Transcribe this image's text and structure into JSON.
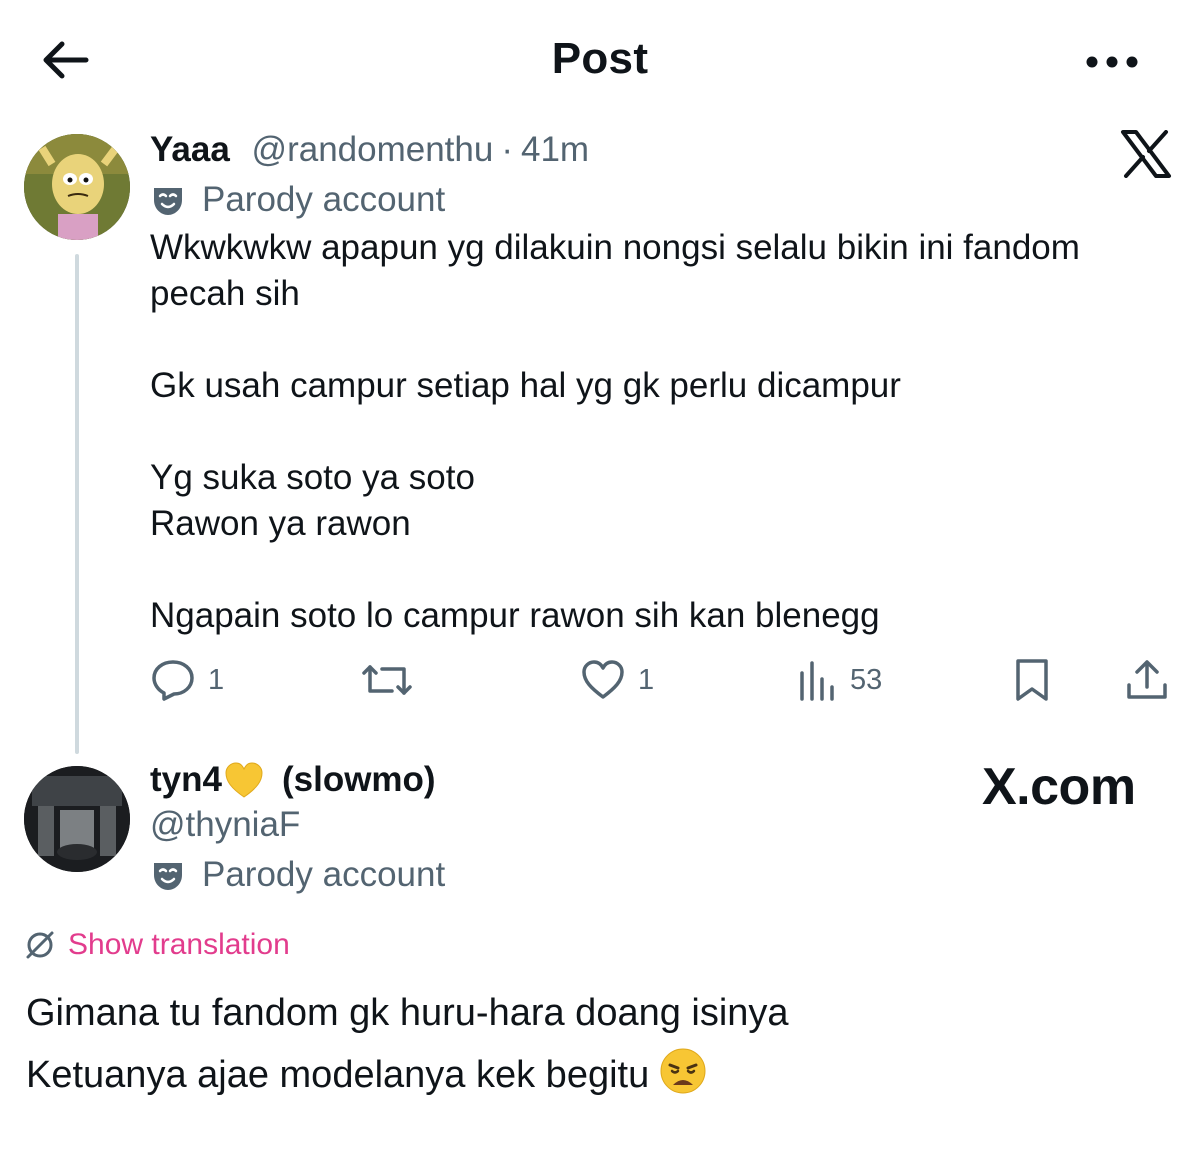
{
  "header": {
    "title": "Post",
    "back_icon": "arrow-left-icon",
    "more_icon": "more-horizontal-icon"
  },
  "parent_post": {
    "display_name": "Yaaa",
    "handle": "@randomenthu",
    "separator": "·",
    "time": "41m",
    "parody_label": "Parody account",
    "text": "Wkwkwkw apapun yg dilakuin nongsi selalu bikin ini fandom\npecah sih\n\nGk usah campur setiap hal yg gk perlu dicampur\n\nYg suka soto ya soto\nRawon ya rawon\n\nNgapain soto lo campur rawon sih kan blenegg",
    "actions": {
      "replies": "1",
      "reposts": "",
      "likes": "1",
      "views": "53"
    }
  },
  "reply_post": {
    "display_name_part1": "tyn4",
    "display_name_emoji": "yellow-heart-emoji",
    "display_name_part2": "(slowmo)",
    "handle": "@thyniaF",
    "parody_label": "Parody account",
    "translate_label": "Show translation",
    "text": "Gimana tu fandom gk huru-hara doang isinya\nKetuanya ajae modelanya kek begitu"
  },
  "watermark": "X.com",
  "colors": {
    "text": "#0f1419",
    "muted": "#536471",
    "translate": "#e23c8d",
    "thread_line": "#cfd9de"
  }
}
